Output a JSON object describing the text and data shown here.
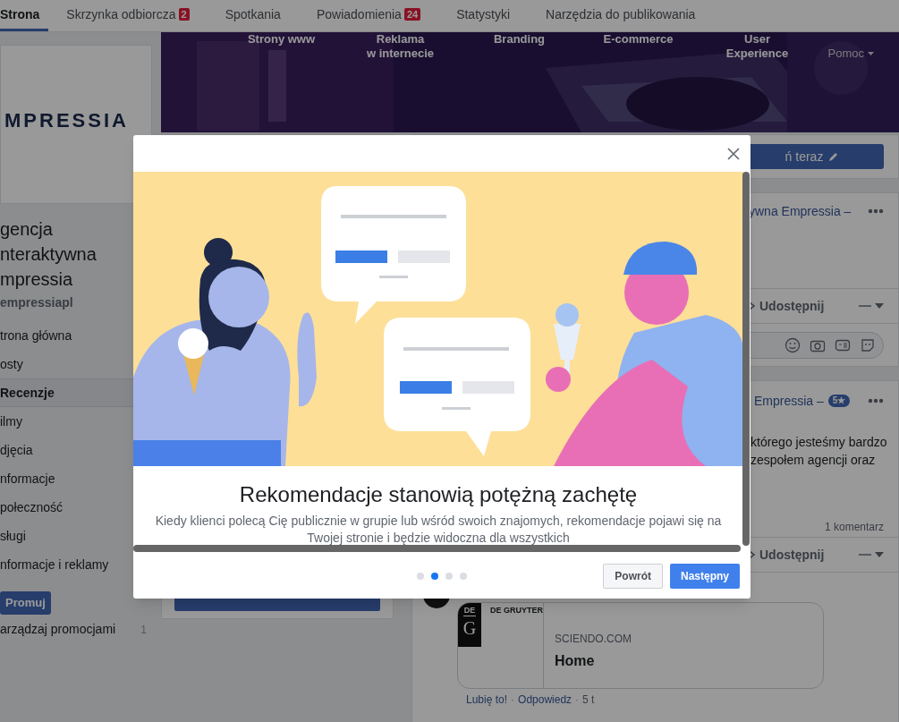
{
  "tabs": [
    {
      "label": "Strona",
      "selected": true
    },
    {
      "label": "Skrzynka odbiorcza",
      "badge": "2",
      "selected": false
    },
    {
      "label": "Spotkania",
      "selected": false
    },
    {
      "label": "Powiadomienia",
      "badge": "24",
      "selected": false
    },
    {
      "label": "Statystyki",
      "selected": false
    },
    {
      "label": "Narzędzia do publikowania",
      "selected": false
    }
  ],
  "cover": {
    "services": [
      {
        "lines": [
          "Strony www"
        ]
      },
      {
        "lines": [
          "Reklama",
          "w internecie"
        ]
      },
      {
        "lines": [
          "Branding"
        ]
      },
      {
        "lines": [
          "E-commerce"
        ]
      },
      {
        "lines": [
          "User",
          "Experience"
        ]
      }
    ],
    "help": "Pomoc"
  },
  "sidebar": {
    "logo": "MPRESSIA",
    "name_lines": [
      "gencja",
      "nteraktywna",
      "mpressia"
    ],
    "username": "empressiapl",
    "items": [
      {
        "label": "trona główna",
        "selected": false
      },
      {
        "label": "osty",
        "selected": false
      },
      {
        "label": "Recenzje",
        "selected": true
      },
      {
        "label": "ilmy",
        "selected": false
      },
      {
        "label": "djęcia",
        "selected": false
      },
      {
        "label": "nformacje",
        "selected": false
      },
      {
        "label": "połeczność",
        "selected": false
      },
      {
        "label": "sługi",
        "selected": false
      },
      {
        "label": "nformacje i reklamy",
        "selected": false
      }
    ],
    "promote_button": "Promuj",
    "manage": {
      "label": "arządzaj promocjami",
      "count": "1"
    }
  },
  "action_button": "ń teraz",
  "posts": [
    {
      "author": "ywna Empressia –",
      "share": "Udostępnij"
    },
    {
      "author": "Empressia –",
      "rating": "5★",
      "text_lines": [
        "którego jesteśmy bardzo",
        "zespołem agencji oraz"
      ],
      "comments": "1 komentarz",
      "share": "Udostępnij",
      "comment": {
        "publisher": "DE GRUYTER",
        "logo_top": "DE",
        "logo_letter": "G",
        "domain": "SCIENDO.COM",
        "title": "Home",
        "actions": [
          "Lubię to!",
          "Odpowiedz"
        ],
        "separator": "·",
        "time": "5 t"
      }
    }
  ],
  "dialog": {
    "title": "Rekomendacje stanowią potężną zachętę",
    "text": "Kiedy klienci polecą Cię publicznie w grupie lub wśród swoich znajomych, rekomendacje pojawi się na Twojej stronie i będzie widoczna dla wszystkich",
    "steps": [
      {
        "selected": false
      },
      {
        "selected": true
      },
      {
        "selected": false
      },
      {
        "selected": false
      }
    ],
    "back": "Powrót",
    "next": "Następny"
  }
}
